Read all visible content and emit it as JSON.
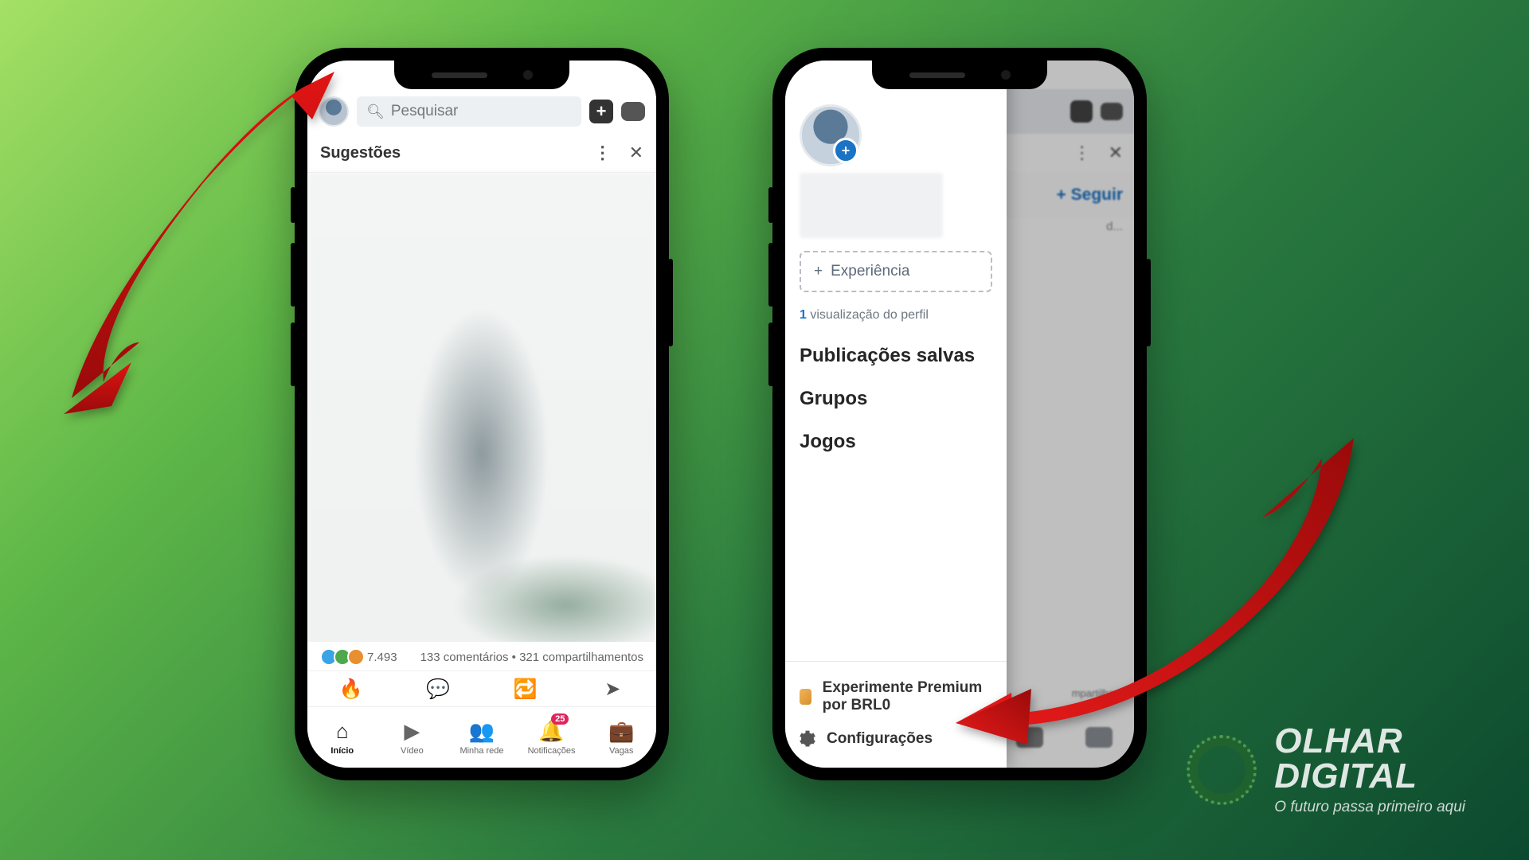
{
  "search": {
    "placeholder": "Pesquisar"
  },
  "sugestoes": "Sugestões",
  "reactions": {
    "count": "7.493",
    "meta": "133 comentários • 321 compartilhamentos"
  },
  "nav": {
    "items": [
      {
        "label": "Início"
      },
      {
        "label": "Vídeo"
      },
      {
        "label": "Minha rede"
      },
      {
        "label": "Notificações",
        "badge": "25"
      },
      {
        "label": "Vagas"
      }
    ]
  },
  "bg": {
    "follow": "+ Seguir",
    "share_txt": "mpartilham",
    "feed_txt": "d..."
  },
  "drawer": {
    "experiencia": "Experiência",
    "views_n": "1",
    "views_txt": "visualização do perfil",
    "menu": [
      "Publicações salvas",
      "Grupos",
      "Jogos"
    ],
    "premium": "Experimente Premium por BRL0",
    "config": "Configurações"
  },
  "brand": {
    "l1": "OLHAR",
    "l2": "DIGITAL",
    "tag": "O futuro passa primeiro aqui"
  }
}
